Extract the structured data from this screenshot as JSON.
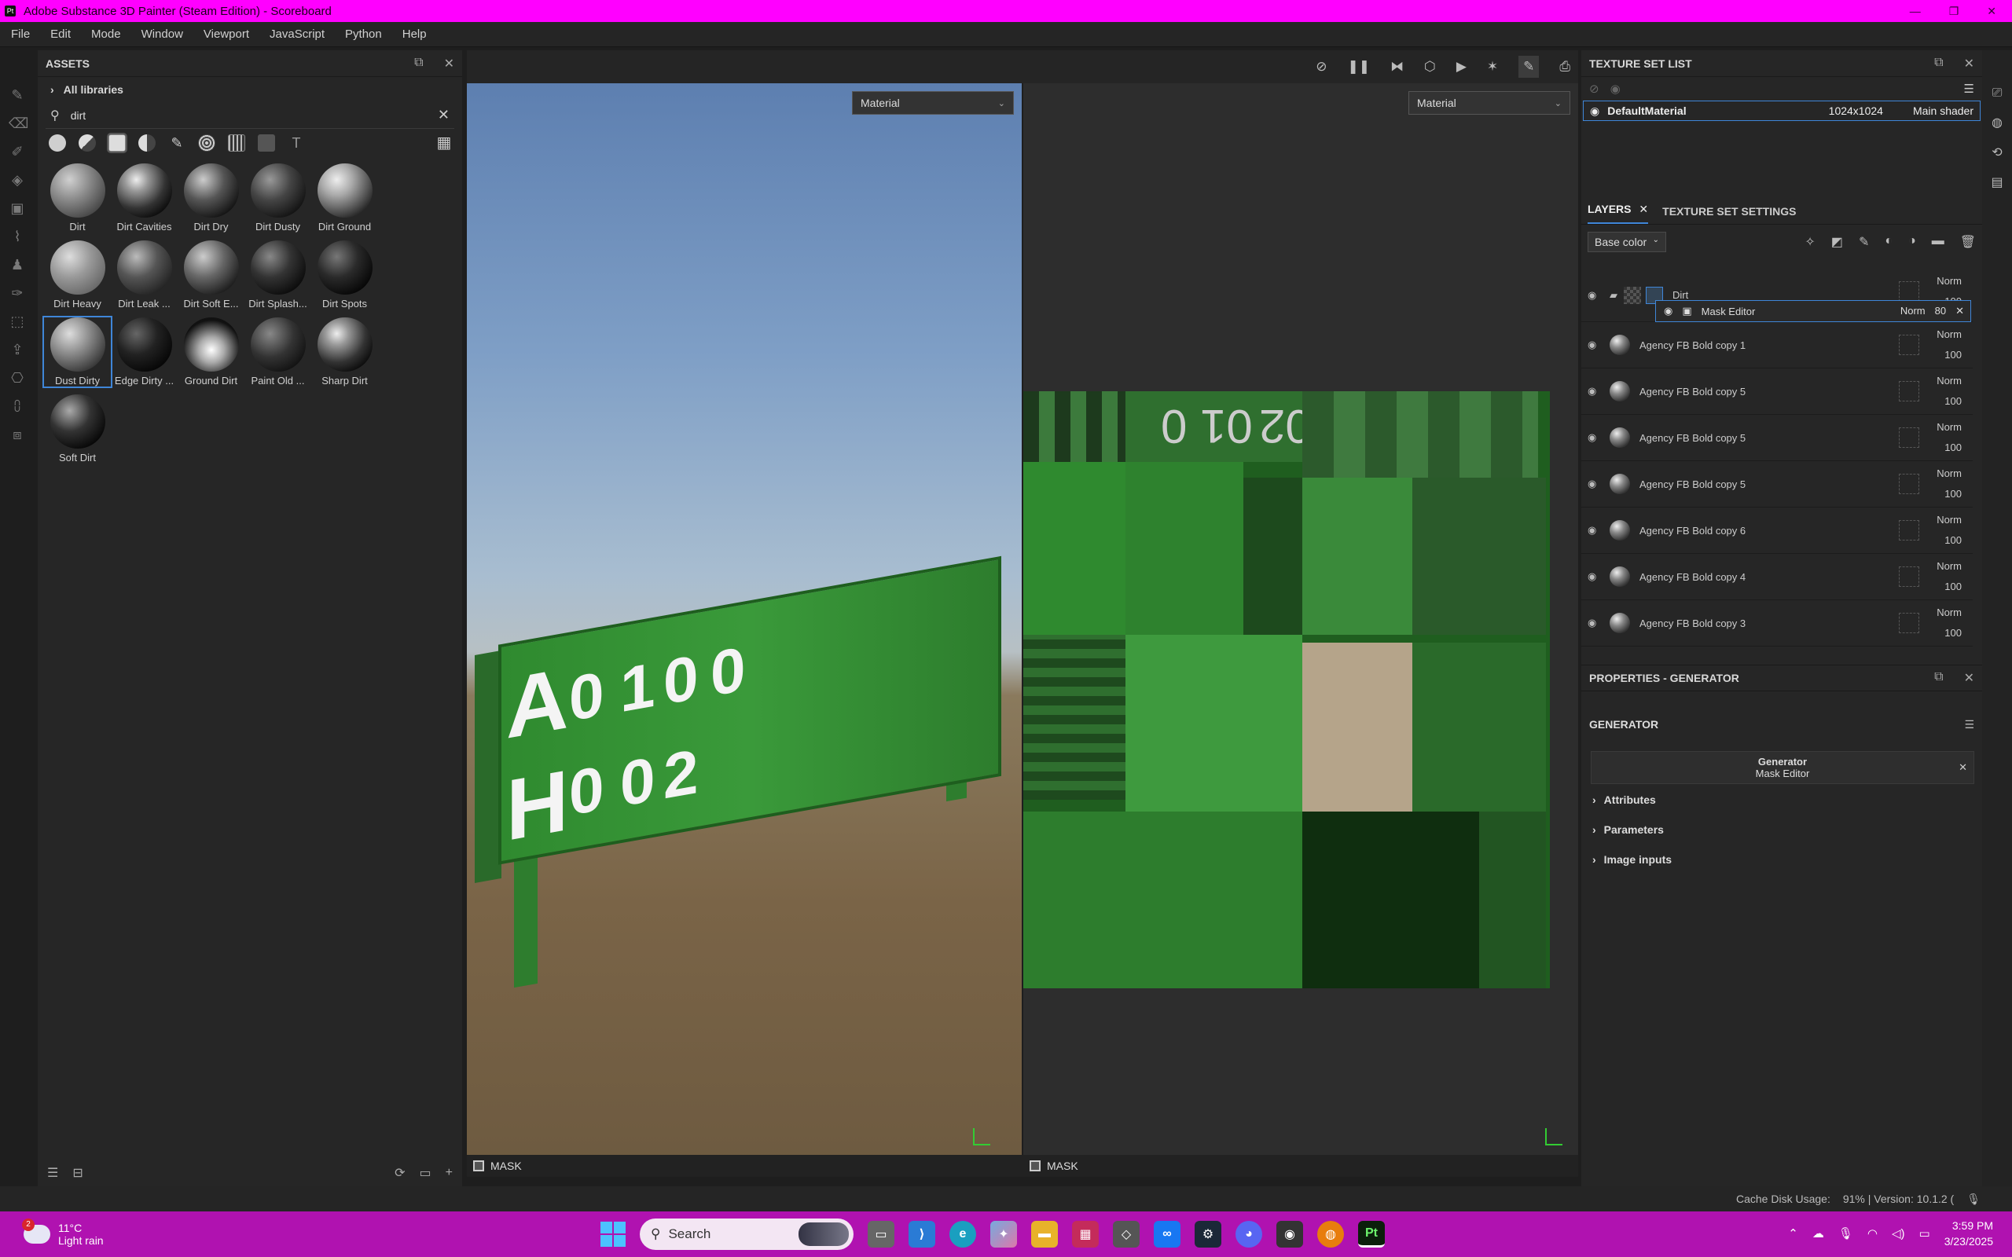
{
  "window": {
    "title": "Adobe Substance 3D Painter (Steam Edition) - Scoreboard",
    "app_icon": "Pt"
  },
  "menu": [
    "File",
    "Edit",
    "Mode",
    "Window",
    "Viewport",
    "JavaScript",
    "Python",
    "Help"
  ],
  "assets": {
    "title": "ASSETS",
    "libraries_label": "All libraries",
    "search_value": "dirt",
    "items": [
      {
        "label": "Dirt"
      },
      {
        "label": "Dirt Cavities"
      },
      {
        "label": "Dirt Dry"
      },
      {
        "label": "Dirt Dusty"
      },
      {
        "label": "Dirt Ground"
      },
      {
        "label": "Dirt Heavy"
      },
      {
        "label": "Dirt Leak ..."
      },
      {
        "label": "Dirt Soft E..."
      },
      {
        "label": "Dirt Splash..."
      },
      {
        "label": "Dirt Spots"
      },
      {
        "label": "Dust Dirty"
      },
      {
        "label": "Edge Dirty ..."
      },
      {
        "label": "Ground Dirt"
      },
      {
        "label": "Paint Old ..."
      },
      {
        "label": "Sharp Dirt"
      },
      {
        "label": "Soft Dirt"
      }
    ],
    "selected_item": "Dust Dirty"
  },
  "viewport": {
    "left_mode": "Material",
    "right_mode": "Material",
    "left_footer": "MASK",
    "right_footer": "MASK",
    "scoreboard": {
      "row1": [
        "A",
        "0",
        "1",
        "0",
        "0"
      ],
      "row2": [
        "H",
        "0",
        "0",
        "2"
      ]
    },
    "uv_digits": [
      "0",
      "01",
      "02"
    ]
  },
  "texture_set_list": {
    "title": "TEXTURE SET LIST",
    "row": {
      "name": "DefaultMaterial",
      "resolution": "1024x1024",
      "shader": "Main shader"
    }
  },
  "layers_panel": {
    "tabs": [
      "LAYERS",
      "TEXTURE SET SETTINGS"
    ],
    "channel": "Base color",
    "layers": [
      {
        "name": "Dirt",
        "blend": "Norm",
        "opacity": "100",
        "type": "folder",
        "sub": {
          "name": "Mask Editor",
          "blend": "Norm",
          "opacity": "80"
        }
      },
      {
        "name": "Agency FB Bold copy 1",
        "blend": "Norm",
        "opacity": "100"
      },
      {
        "name": "Agency FB Bold copy 5",
        "blend": "Norm",
        "opacity": "100"
      },
      {
        "name": "Agency FB Bold copy 5",
        "blend": "Norm",
        "opacity": "100"
      },
      {
        "name": "Agency FB Bold copy 5",
        "blend": "Norm",
        "opacity": "100"
      },
      {
        "name": "Agency FB Bold copy 6",
        "blend": "Norm",
        "opacity": "100"
      },
      {
        "name": "Agency FB Bold copy 4",
        "blend": "Norm",
        "opacity": "100"
      },
      {
        "name": "Agency FB Bold copy 3",
        "blend": "Norm",
        "opacity": "100"
      }
    ]
  },
  "properties": {
    "title": "PROPERTIES - GENERATOR",
    "section": "GENERATOR",
    "generator_title": "Generator",
    "generator_sub": "Mask Editor",
    "groups": [
      "Attributes",
      "Parameters",
      "Image inputs"
    ]
  },
  "statusbar": {
    "cache": "Cache Disk Usage:",
    "pct": "91% | Version: 10.1.2 ("
  },
  "taskbar": {
    "weather_temp": "11°C",
    "weather_desc": "Light rain",
    "weather_badge": "2",
    "search_placeholder": "Search",
    "time": "3:59 PM",
    "date": "3/23/2025"
  },
  "colors": {
    "titlebar": "#ff00ff",
    "taskbar": "#b012b0",
    "accent": "#3f86d8"
  }
}
